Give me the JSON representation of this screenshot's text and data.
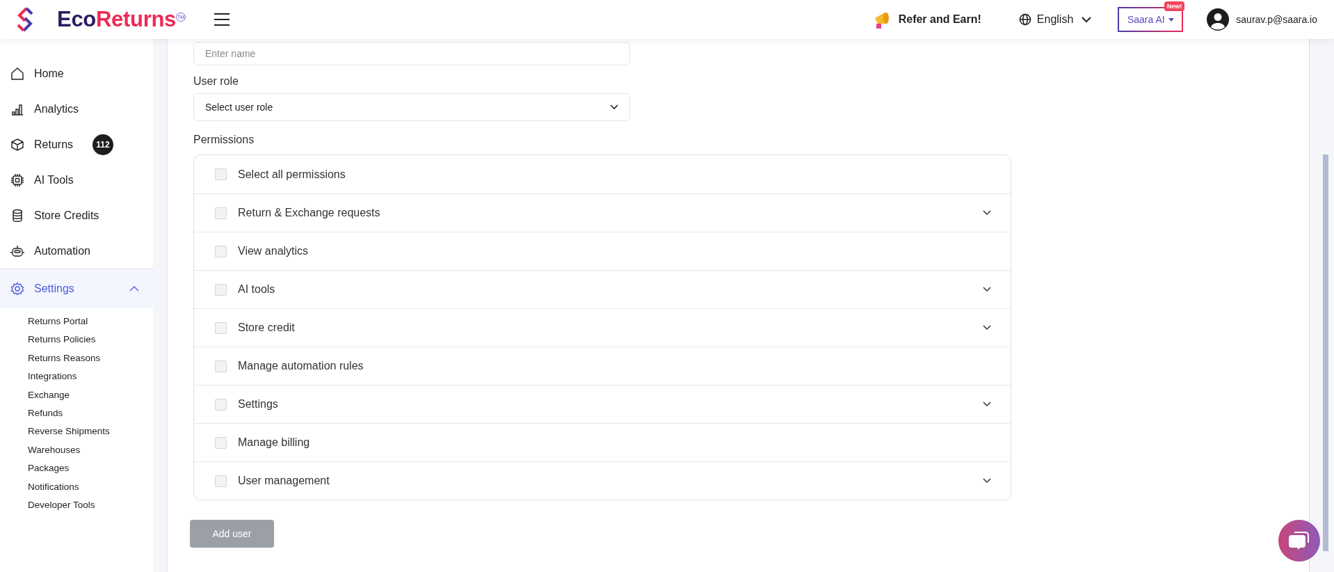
{
  "header": {
    "logo": {
      "first": "Eco",
      "second": "Returns",
      "mark": "TM"
    },
    "refer": "Refer and Earn!",
    "language": "English",
    "ai_button": {
      "label": "Saara AI",
      "badge": "New!"
    },
    "user": "saurav.p@saara.io"
  },
  "sidebar": {
    "items": [
      {
        "label": "Home",
        "selected": false
      },
      {
        "label": "Analytics",
        "selected": false
      },
      {
        "label": "Returns",
        "selected": false,
        "badge": "112"
      },
      {
        "label": "AI Tools",
        "selected": false
      },
      {
        "label": "Store Credits",
        "selected": false
      },
      {
        "label": "Automation",
        "selected": false
      },
      {
        "label": "Settings",
        "selected": true,
        "expanded": true,
        "children": [
          "Returns Portal",
          "Returns Policies",
          "Returns Reasons",
          "Integrations",
          "Exchange",
          "Refunds",
          "Reverse Shipments",
          "Warehouses",
          "Packages",
          "Notifications",
          "Developer Tools"
        ]
      }
    ]
  },
  "form": {
    "name_field": {
      "placeholder": "Enter name"
    },
    "role": {
      "label": "User role",
      "placeholder": "Select user role"
    },
    "permissions": {
      "label": "Permissions",
      "rows": [
        {
          "label": "Select all permissions",
          "checked": false,
          "has_options": false
        },
        {
          "label": "Return & Exchange requests",
          "checked": false,
          "has_options": true
        },
        {
          "label": "View analytics",
          "checked": false,
          "has_options": false
        },
        {
          "label": "AI tools",
          "checked": false,
          "has_options": true
        },
        {
          "label": "Store credit",
          "checked": false,
          "has_options": true
        },
        {
          "label": "Manage automation rules",
          "checked": false,
          "has_options": false
        },
        {
          "label": "Settings",
          "checked": false,
          "has_options": true
        },
        {
          "label": "Manage billing",
          "checked": false,
          "has_options": false
        },
        {
          "label": "User management",
          "checked": false,
          "has_options": true
        }
      ]
    },
    "submit": {
      "label": "Add user",
      "disabled": true
    }
  }
}
